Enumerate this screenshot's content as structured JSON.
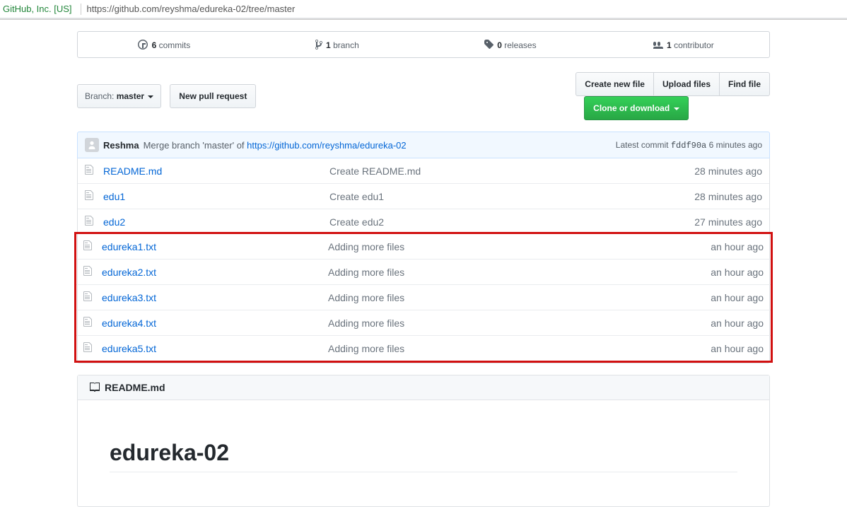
{
  "addressbar": {
    "secure_text": "GitHub, Inc. [US]",
    "url": "https://github.com/reyshma/edureka-02/tree/master"
  },
  "summary": {
    "commits_count": "6",
    "commits_label": "commits",
    "branches_count": "1",
    "branches_label": "branch",
    "releases_count": "0",
    "releases_label": "releases",
    "contributors_count": "1",
    "contributors_label": "contributor"
  },
  "toolbar": {
    "branch_lbl": "Branch:",
    "branch_val": "master",
    "new_pr": "New pull request",
    "create_new_file": "Create new file",
    "upload_files": "Upload files",
    "find_file": "Find file",
    "clone": "Clone or download"
  },
  "tease": {
    "author": "Reshma",
    "message_pre": "Merge branch 'master' of ",
    "message_link": "https://github.com/reyshma/edureka-02",
    "latest_commit_label": "Latest commit",
    "sha": "fddf90a",
    "time": "6 minutes ago"
  },
  "files": {
    "plain": [
      {
        "name": "README.md",
        "msg": "Create README.md",
        "time": "28 minutes ago"
      },
      {
        "name": "edu1",
        "msg": "Create edu1",
        "time": "28 minutes ago"
      },
      {
        "name": "edu2",
        "msg": "Create edu2",
        "time": "27 minutes ago"
      }
    ],
    "highlighted": [
      {
        "name": "edureka1.txt",
        "msg": "Adding more files",
        "time": "an hour ago"
      },
      {
        "name": "edureka2.txt",
        "msg": "Adding more files",
        "time": "an hour ago"
      },
      {
        "name": "edureka3.txt",
        "msg": "Adding more files",
        "time": "an hour ago"
      },
      {
        "name": "edureka4.txt",
        "msg": "Adding more files",
        "time": "an hour ago"
      },
      {
        "name": "edureka5.txt",
        "msg": "Adding more files",
        "time": "an hour ago"
      }
    ]
  },
  "readme": {
    "filename": "README.md",
    "heading": "edureka-02"
  }
}
